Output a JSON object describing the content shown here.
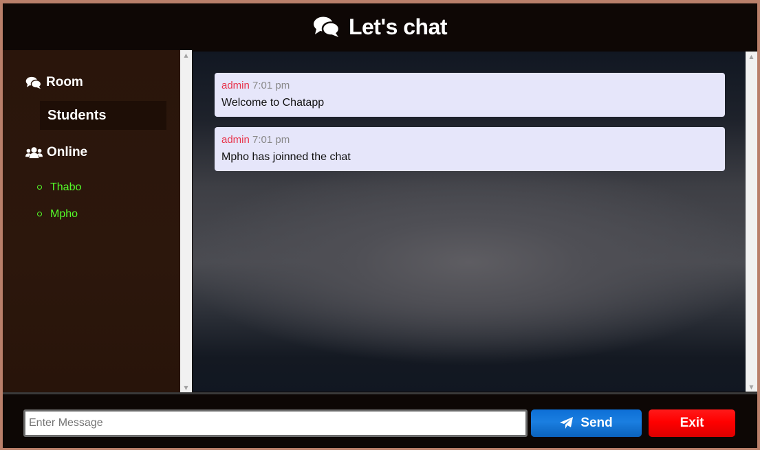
{
  "header": {
    "title": "Let's chat",
    "icon": "comments-icon"
  },
  "sidebar": {
    "room_heading": "Room",
    "room_name": "Students",
    "online_heading": "Online",
    "users": [
      {
        "name": "Thabo"
      },
      {
        "name": "Mpho"
      }
    ]
  },
  "messages": [
    {
      "user": "admin",
      "time": "7:01 pm",
      "text": "Welcome to Chatapp"
    },
    {
      "user": "admin",
      "time": "7:01 pm",
      "text": "Mpho has joinned the chat"
    }
  ],
  "footer": {
    "input_placeholder": "Enter Message",
    "input_value": "",
    "send_label": "Send",
    "exit_label": "Exit"
  },
  "colors": {
    "send_button": "#0d6fd6",
    "exit_button": "#ff0000",
    "online_user": "#55ff2a",
    "message_user": "#e8334b",
    "message_bg": "#e6e6fa"
  }
}
